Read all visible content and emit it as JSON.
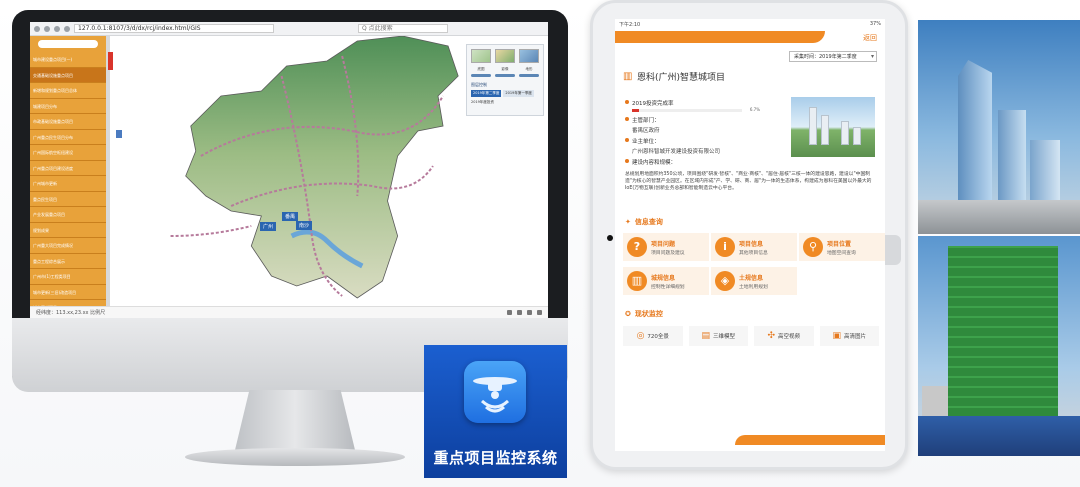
{
  "desktop": {
    "url": "127.0.0.1:8107/3/d/dx/rcj/index.html/GIS",
    "search_placeholder": "Q 点此搜索",
    "sidebar_items": [
      "城市建设重点项目(一)",
      "交通基础设施重点项目",
      "新增和规划重点项目总体",
      "城建项目分布",
      "市政基础设施重点项目",
      "广州重点民生项目分布",
      "广州国际航空枢纽建设",
      "广州重点项目建设进度",
      "广州城市更新",
      "重点民生项目",
      "产业发展重点项目",
      "规划成果",
      "广州重大项目完成情况",
      "重点工程综合展示",
      "广州市(1)工程类项目",
      "城市更新(三旧)改造项目",
      "城市更新项目",
      "其他"
    ],
    "map_panel": {
      "layer_labels": [
        "底图",
        "影像",
        "地形"
      ],
      "title": "图层控制",
      "tabs": [
        "2019年第二季度",
        "2019年第一季度"
      ],
      "value": "2019年度投资"
    },
    "map_pins": [
      "广州",
      "番禺",
      "南沙"
    ],
    "status_left": "经纬度：113.xx,23.xx 比例尺"
  },
  "app_icon": {
    "title": "重点项目监控系统"
  },
  "tablet": {
    "status_left": "下午2:10",
    "status_right": "37%",
    "back_label": "返回",
    "period": "采集时间：2019年第二季度",
    "project_title": "恩科(广州)智慧城项目",
    "progress_label": "2019投资完成率",
    "progress_value": 0.06,
    "progress_text": "6.7%",
    "dept_label": "主管部门：",
    "dept_value": "番禺区政府",
    "owner_label": "业主单位：",
    "owner_value": "广州恩科智城开发建设投资有限公司",
    "scope_label": "建设内容和规模：",
    "description": "总规划用地面积约350公顷，项目围绕\"研发·智核\"、\"商业·商核\"、\"居住·居核\"三核一体的建设思路，建设以\"中国制造\"为核心的智慧产业园区。在区域内形成\"产、学、研、商、居\"为一体的生态体系，构建成为恩科在美国以外最大的IoE(万物互联)创新业务总部和智能制造云中心平台。",
    "info_section": "信息查询",
    "query_cards": [
      {
        "icon": "question-icon",
        "title": "项目问题",
        "sub": "项目问题及建议"
      },
      {
        "icon": "info-icon",
        "title": "项目信息",
        "sub": "其他项目信息"
      },
      {
        "icon": "location-icon",
        "title": "项目位置",
        "sub": "地图空间查询"
      },
      {
        "icon": "city-icon",
        "title": "城规信息",
        "sub": "控制性详细规划"
      },
      {
        "icon": "land-icon",
        "title": "土规信息",
        "sub": "土地利用规划"
      }
    ],
    "monitor_section": "现状监控",
    "monitor_buttons": [
      "720全景",
      "三维模型",
      "高空视频",
      "高清图片"
    ]
  }
}
